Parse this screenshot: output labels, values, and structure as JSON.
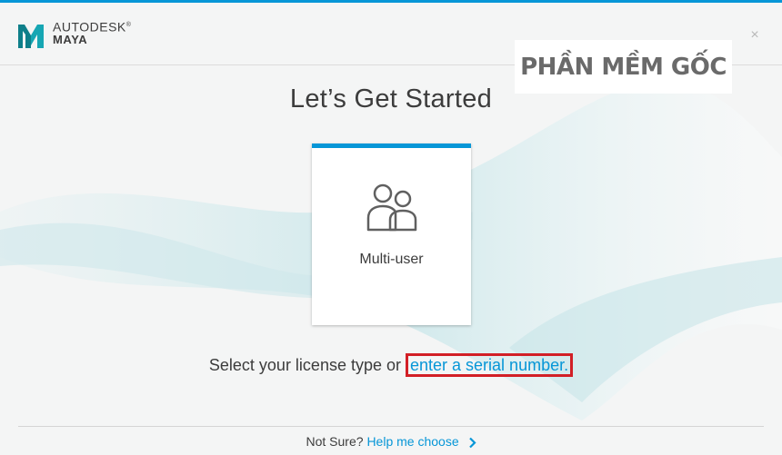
{
  "header": {
    "brand_line1": "AUTODESK",
    "brand_line2": "MAYA",
    "trademark": "®",
    "close_glyph": "×"
  },
  "watermark": "PHẦN MỀM GỐC",
  "title": "Let’s Get Started",
  "card": {
    "label": "Multi-user",
    "icon": "multi-user-icon"
  },
  "prompt": {
    "text": "Select your license type or ",
    "link_text": "enter a serial number."
  },
  "footer": {
    "not_sure": "Not Sure?",
    "help_link": "Help me choose",
    "icon": "chevron-right-icon"
  },
  "colors": {
    "accent": "#0696d7",
    "highlight_box": "#d21f26",
    "text": "#3c3c3c"
  }
}
